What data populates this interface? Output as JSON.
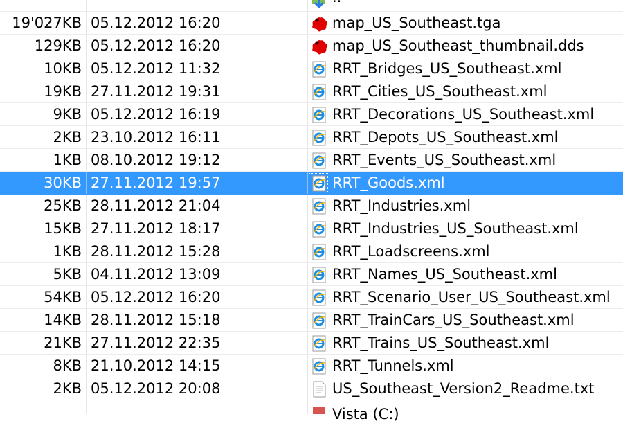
{
  "files": [
    {
      "size": "",
      "date": "",
      "name": "..",
      "icon": "up-folder-icon",
      "selected": false
    },
    {
      "size": "19'027KB",
      "date": "05.12.2012 16:20",
      "name": "map_US_Southeast.tga",
      "icon": "tga-image-icon",
      "selected": false
    },
    {
      "size": "129KB",
      "date": "05.12.2012 16:20",
      "name": "map_US_Southeast_thumbnail.dds",
      "icon": "dds-image-icon",
      "selected": false
    },
    {
      "size": "10KB",
      "date": "05.12.2012 11:32",
      "name": "RRT_Bridges_US_Southeast.xml",
      "icon": "xml-file-icon",
      "selected": false
    },
    {
      "size": "19KB",
      "date": "27.11.2012 19:31",
      "name": "RRT_Cities_US_Southeast.xml",
      "icon": "xml-file-icon",
      "selected": false
    },
    {
      "size": "9KB",
      "date": "05.12.2012 16:19",
      "name": "RRT_Decorations_US_Southeast.xml",
      "icon": "xml-file-icon",
      "selected": false
    },
    {
      "size": "2KB",
      "date": "23.10.2012 16:11",
      "name": "RRT_Depots_US_Southeast.xml",
      "icon": "xml-file-icon",
      "selected": false
    },
    {
      "size": "1KB",
      "date": "08.10.2012 19:12",
      "name": "RRT_Events_US_Southeast.xml",
      "icon": "xml-file-icon",
      "selected": false
    },
    {
      "size": "30KB",
      "date": "27.11.2012 19:57",
      "name": "RRT_Goods.xml",
      "icon": "xml-file-icon",
      "selected": true
    },
    {
      "size": "25KB",
      "date": "28.11.2012 21:04",
      "name": "RRT_Industries.xml",
      "icon": "xml-file-icon",
      "selected": false
    },
    {
      "size": "15KB",
      "date": "27.11.2012 18:17",
      "name": "RRT_Industries_US_Southeast.xml",
      "icon": "xml-file-icon",
      "selected": false
    },
    {
      "size": "1KB",
      "date": "28.11.2012 15:28",
      "name": "RRT_Loadscreens.xml",
      "icon": "xml-file-icon",
      "selected": false
    },
    {
      "size": "5KB",
      "date": "04.11.2012 13:09",
      "name": "RRT_Names_US_Southeast.xml",
      "icon": "xml-file-icon",
      "selected": false
    },
    {
      "size": "54KB",
      "date": "05.12.2012 16:20",
      "name": "RRT_Scenario_User_US_Southeast.xml",
      "icon": "xml-file-icon",
      "selected": false
    },
    {
      "size": "14KB",
      "date": "28.11.2012 15:18",
      "name": "RRT_TrainCars_US_Southeast.xml",
      "icon": "xml-file-icon",
      "selected": false
    },
    {
      "size": "21KB",
      "date": "27.11.2012 22:35",
      "name": "RRT_Trains_US_Southeast.xml",
      "icon": "xml-file-icon",
      "selected": false
    },
    {
      "size": "8KB",
      "date": "21.10.2012 14:15",
      "name": "RRT_Tunnels.xml",
      "icon": "xml-file-icon",
      "selected": false
    },
    {
      "size": "2KB",
      "date": "05.12.2012 20:08",
      "name": "US_Southeast_Version2_Readme.txt",
      "icon": "text-file-icon",
      "selected": false
    },
    {
      "size": "",
      "date": "",
      "name": "Vista (C:)",
      "icon": "drive-icon",
      "selected": false
    }
  ],
  "colors": {
    "selection": "#3399ff",
    "xml_icon": "#1e8fe0",
    "image_icon": "#e00000"
  }
}
